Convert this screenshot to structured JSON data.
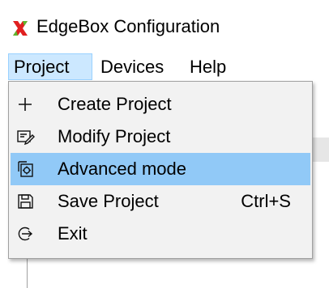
{
  "window": {
    "title": "EdgeBox Configuration",
    "icon": "red-green-x-icon"
  },
  "menubar": {
    "items": [
      {
        "label": "Project",
        "active": true
      },
      {
        "label": "Devices",
        "active": false
      },
      {
        "label": "Help",
        "active": false
      }
    ]
  },
  "project_menu": {
    "items": [
      {
        "label": "Create Project",
        "icon": "plus-icon",
        "shortcut": "",
        "highlighted": false
      },
      {
        "label": "Modify Project",
        "icon": "edit-document-icon",
        "shortcut": "",
        "highlighted": false
      },
      {
        "label": "Advanced mode",
        "icon": "settings-copy-icon",
        "shortcut": "",
        "highlighted": true
      },
      {
        "label": "Save Project",
        "icon": "floppy-disk-icon",
        "shortcut": "Ctrl+S",
        "highlighted": false
      },
      {
        "label": "Exit",
        "icon": "exit-icon",
        "shortcut": "",
        "highlighted": false
      }
    ]
  },
  "colors": {
    "menu_active_bg": "#cce8ff",
    "item_highlight_bg": "#91c9f7",
    "dropdown_bg": "#f2f2f2",
    "logo_red": "#e02020",
    "logo_green": "#5cb82e"
  }
}
